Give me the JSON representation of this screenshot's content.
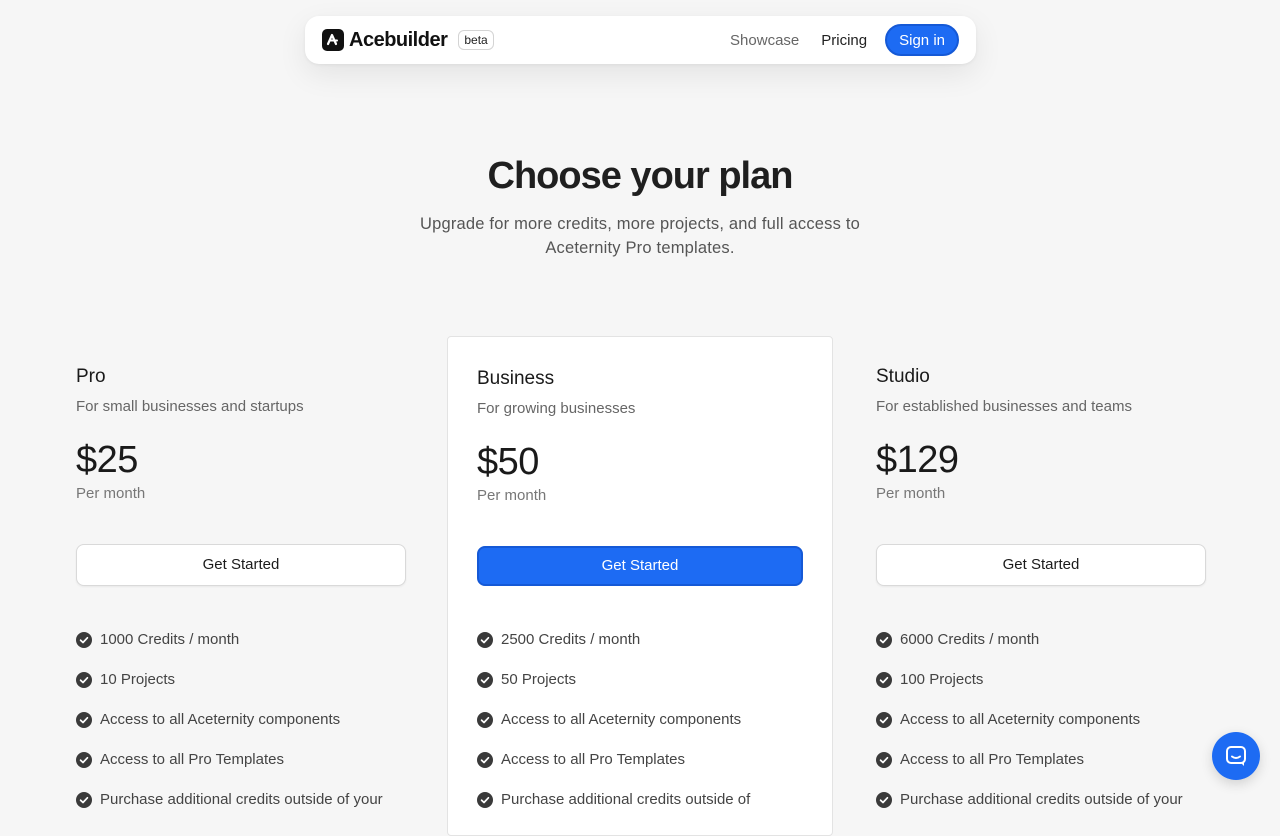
{
  "nav": {
    "brand": "Acebuilder",
    "badge": "beta",
    "links": [
      "Showcase",
      "Pricing"
    ],
    "signin": "Sign in"
  },
  "hero": {
    "title": "Choose your plan",
    "subtitle": "Upgrade for more credits, more projects, and full access to Aceternity Pro templates."
  },
  "plans": [
    {
      "name": "Pro",
      "description": "For small businesses and startups",
      "price": "$25",
      "period": "Per month",
      "cta": "Get Started",
      "features": [
        "1000 Credits / month",
        "10 Projects",
        "Access to all Aceternity components",
        "Access to all Pro Templates",
        "Purchase additional credits outside of your"
      ]
    },
    {
      "name": "Business",
      "description": "For growing businesses",
      "price": "$50",
      "period": "Per month",
      "cta": "Get Started",
      "features": [
        "2500 Credits / month",
        "50 Projects",
        "Access to all Aceternity components",
        "Access to all Pro Templates",
        "Purchase additional credits outside of"
      ]
    },
    {
      "name": "Studio",
      "description": "For established businesses and teams",
      "price": "$129",
      "period": "Per month",
      "cta": "Get Started",
      "features": [
        "6000 Credits / month",
        "100 Projects",
        "Access to all Aceternity components",
        "Access to all Pro Templates",
        "Purchase additional credits outside of your"
      ]
    }
  ],
  "icons": {
    "logo": "acebuilder-logo-icon",
    "check": "check-circle-icon",
    "chat": "chat-icon"
  },
  "colors": {
    "accent": "#1d6bf3",
    "background": "#f6f6f6",
    "card": "#ffffff"
  }
}
